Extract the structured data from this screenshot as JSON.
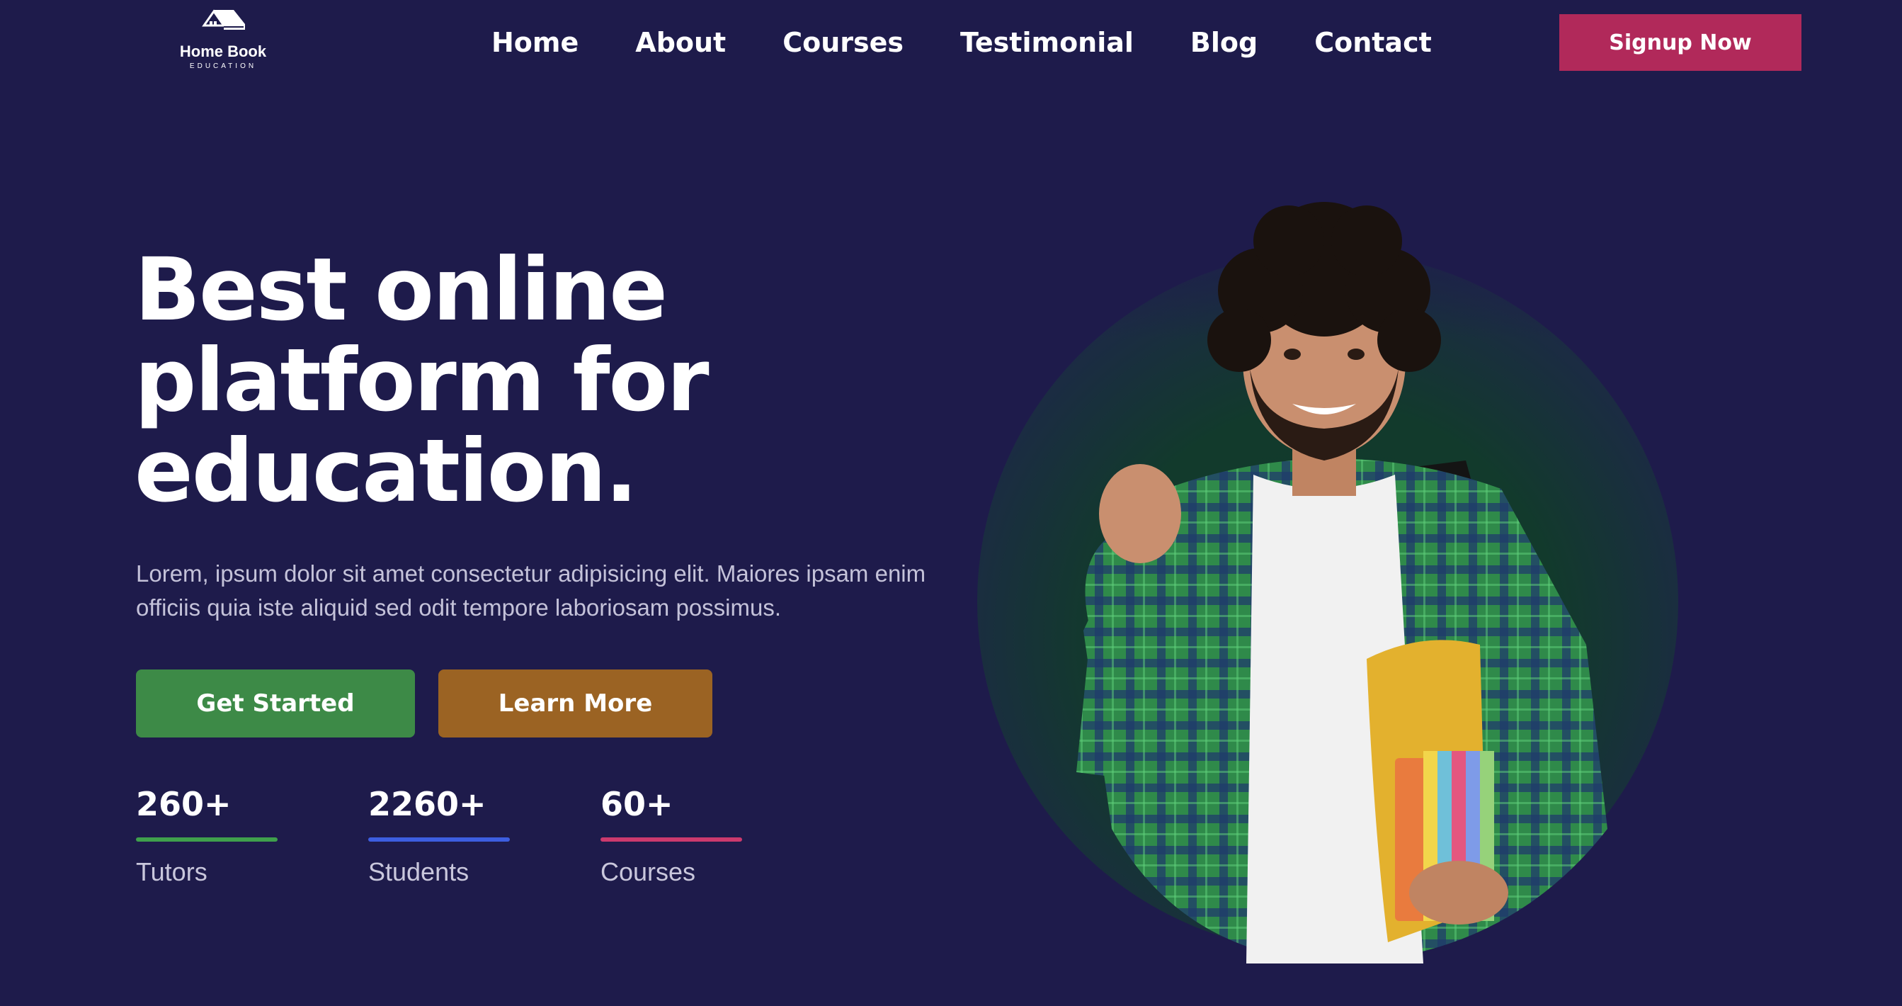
{
  "header": {
    "logo": {
      "title": "Home Book",
      "subtitle": "EDUCATION"
    },
    "nav": [
      "Home",
      "About",
      "Courses",
      "Testimonial",
      "Blog",
      "Contact"
    ],
    "signup_label": "Signup Now"
  },
  "hero": {
    "headline": [
      "Best online",
      "platform for",
      "education."
    ],
    "subtext": "Lorem, ipsum dolor sit amet consectetur adipisicing elit. Maiores ipsam enim officiis quia iste aliquid sed odit tempore laboriosam possimus.",
    "buttons": {
      "get_started": "Get Started",
      "learn_more": "Learn More"
    },
    "stats": [
      {
        "value": "260+",
        "label": "Tutors",
        "color": "#3fa04c"
      },
      {
        "value": "2260+",
        "label": "Students",
        "color": "#3d5ee0"
      },
      {
        "value": "60+",
        "label": "Courses",
        "color": "#cc3a6d"
      }
    ]
  },
  "colors": {
    "background": "#1e1b4b",
    "signup": "#b1295a",
    "get_started": "#3d8a47",
    "learn_more": "#9b6323"
  }
}
